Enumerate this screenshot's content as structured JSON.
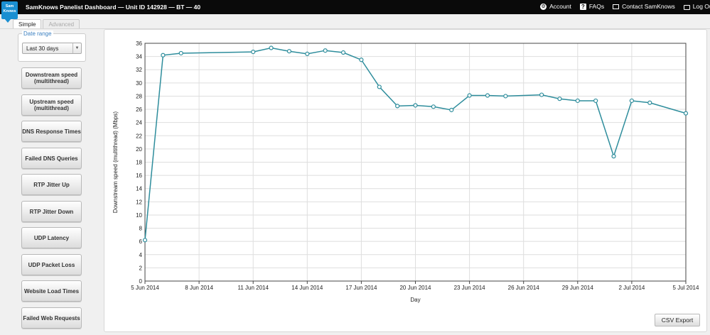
{
  "header": {
    "logo_text": "Sam Knows",
    "title": "SamKnows Panelist Dashboard — Unit ID 142928 — BT — 40",
    "nav": [
      {
        "label": "Account",
        "icon": "gear-icon"
      },
      {
        "label": "FAQs",
        "icon": "question-icon"
      },
      {
        "label": "Contact SamKnows",
        "icon": "envelope-icon"
      },
      {
        "label": "Log Out",
        "icon": "lock-icon"
      }
    ]
  },
  "tabs": [
    {
      "label": "Simple",
      "active": true
    },
    {
      "label": "Advanced",
      "active": false
    }
  ],
  "sidebar": {
    "date_range_label": "Date range",
    "date_range_value": "Last 30 days",
    "metrics": [
      "Downstream speed (multithread)",
      "Upstream speed (multithread)",
      "DNS Response Times",
      "Failed DNS Queries",
      "RTP Jitter Up",
      "RTP Jitter Down",
      "UDP Latency",
      "UDP Packet Loss",
      "Website Load Times",
      "Failed Web Requests"
    ]
  },
  "csv_export_label": "CSV Export",
  "colors": {
    "line": "#2e8d9c",
    "header_bg": "#0a0a0a",
    "accent": "#1a8fd1"
  },
  "chart_data": {
    "type": "line",
    "title": "",
    "xlabel": "Day",
    "ylabel": "Downstream speed (multithread) (Mbps)",
    "ylim": [
      0,
      36
    ],
    "ytick_step": 2,
    "xlim": [
      "2014-06-05",
      "2014-07-05"
    ],
    "xtick_labels": [
      "5 Jun 2014",
      "8 Jun 2014",
      "11 Jun 2014",
      "14 Jun 2014",
      "17 Jun 2014",
      "20 Jun 2014",
      "23 Jun 2014",
      "26 Jun 2014",
      "29 Jun 2014",
      "2 Jul 2014",
      "5 Jul 2014"
    ],
    "grid": true,
    "series": [
      {
        "x": [
          "2014-06-05",
          "2014-06-06",
          "2014-06-07",
          "2014-06-11",
          "2014-06-12",
          "2014-06-13",
          "2014-06-14",
          "2014-06-15",
          "2014-06-16",
          "2014-06-17",
          "2014-06-18",
          "2014-06-19",
          "2014-06-20",
          "2014-06-21",
          "2014-06-22",
          "2014-06-23",
          "2014-06-24",
          "2014-06-25",
          "2014-06-27",
          "2014-06-28",
          "2014-06-29",
          "2014-06-30",
          "2014-07-01",
          "2014-07-02",
          "2014-07-03",
          "2014-07-05"
        ],
        "values": [
          6.2,
          34.2,
          34.5,
          34.7,
          35.3,
          34.8,
          34.4,
          34.9,
          34.6,
          33.5,
          29.4,
          26.5,
          26.6,
          26.4,
          25.9,
          28.1,
          28.1,
          28.0,
          28.2,
          27.6,
          27.3,
          27.3,
          18.9,
          27.3,
          27.0,
          25.4
        ]
      }
    ]
  }
}
